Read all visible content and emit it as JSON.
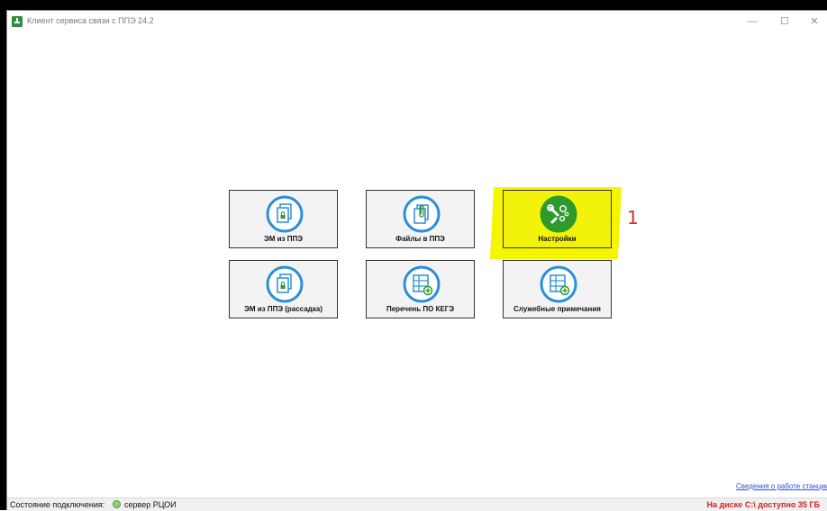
{
  "window": {
    "title": "Клиент сервиса связи с ППЭ 24.2",
    "minimize": "—",
    "maximize": "☐",
    "close": "✕"
  },
  "tiles": [
    {
      "label": "ЭМ из ППЭ",
      "icon": "encrypted-docs-icon"
    },
    {
      "label": "Файлы в ППЭ",
      "icon": "attachment-docs-icon"
    },
    {
      "label": "Настройки",
      "icon": "settings-tools-icon"
    },
    {
      "label": "ЭМ из ППЭ (рассадка)",
      "icon": "encrypted-docs-icon"
    },
    {
      "label": "Перечень ПО КЕГЭ",
      "icon": "table-add-icon"
    },
    {
      "label": "Служебные примечания",
      "icon": "table-add-icon"
    }
  ],
  "annotation": "1",
  "footer": {
    "link": "Сведения о работе станции",
    "status_label": "Состояние подключения:",
    "server": "сервер РЦОИ",
    "disk": "На диске C:\\ доступно 35 ГБ"
  },
  "colors": {
    "icon_blue": "#2a8fd8",
    "icon_green": "#2e9a2e",
    "highlight": "#f6f500",
    "annotation": "#d92a2a",
    "disk_warning": "#d62020"
  }
}
